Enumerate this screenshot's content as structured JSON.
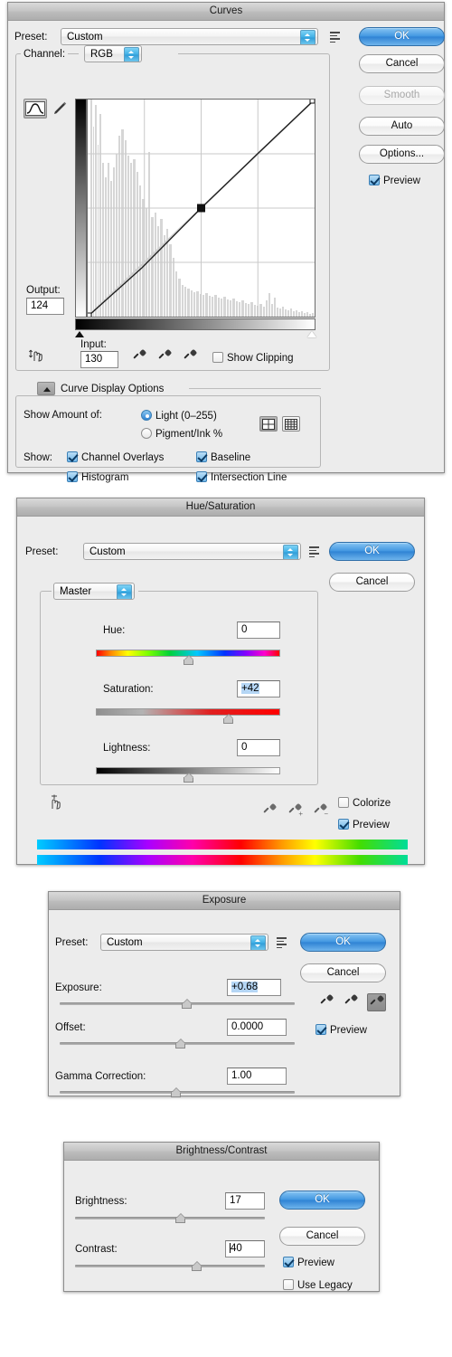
{
  "curves": {
    "title": "Curves",
    "preset_label": "Preset:",
    "preset_value": "Custom",
    "channel_label": "Channel:",
    "channel_value": "RGB",
    "output_label": "Output:",
    "output_value": "124",
    "input_label": "Input:",
    "input_value": "130",
    "show_clipping_label": "Show Clipping",
    "curve_display_options_label": "Curve Display Options",
    "show_amount_of_label": "Show Amount of:",
    "light_label": "Light  (0–255)",
    "pigment_label": "Pigment/Ink %",
    "show_label": "Show:",
    "channel_overlays_label": "Channel Overlays",
    "baseline_label": "Baseline",
    "histogram_label": "Histogram",
    "intersection_line_label": "Intersection Line",
    "buttons": {
      "ok": "OK",
      "cancel": "Cancel",
      "smooth": "Smooth",
      "auto": "Auto",
      "options": "Options..."
    },
    "preview_label": "Preview"
  },
  "hue_saturation": {
    "title": "Hue/Saturation",
    "preset_label": "Preset:",
    "preset_value": "Custom",
    "range_value": "Master",
    "hue_label": "Hue:",
    "hue_value": "0",
    "saturation_label": "Saturation:",
    "saturation_value": "+42",
    "lightness_label": "Lightness:",
    "lightness_value": "0",
    "colorize_label": "Colorize",
    "preview_label": "Preview",
    "buttons": {
      "ok": "OK",
      "cancel": "Cancel"
    }
  },
  "exposure": {
    "title": "Exposure",
    "preset_label": "Preset:",
    "preset_value": "Custom",
    "exposure_label": "Exposure:",
    "exposure_value": "+0.68",
    "offset_label": "Offset:",
    "offset_value": "0.0000",
    "gamma_label": "Gamma Correction:",
    "gamma_value": "1.00",
    "preview_label": "Preview",
    "buttons": {
      "ok": "OK",
      "cancel": "Cancel"
    }
  },
  "brightness_contrast": {
    "title": "Brightness/Contrast",
    "brightness_label": "Brightness:",
    "brightness_value": "17",
    "contrast_label": "Contrast:",
    "contrast_value": "40",
    "preview_label": "Preview",
    "use_legacy_label": "Use Legacy",
    "buttons": {
      "ok": "OK",
      "cancel": "Cancel"
    }
  },
  "colors": {
    "dialog_bg": "#ececec",
    "titlebar": "#bcbcbc",
    "accent_blue": "#2e82d4",
    "selection_blue": "#b5d6f5"
  }
}
